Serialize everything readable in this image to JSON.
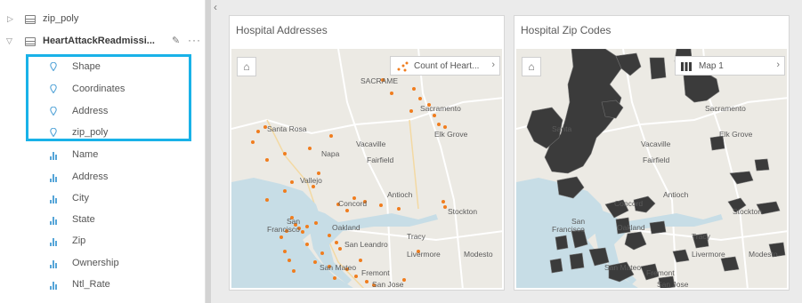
{
  "data_pane": {
    "datasets": [
      {
        "name": "zip_poly",
        "expanded": false
      },
      {
        "name": "HeartAttackReadmissi...",
        "expanded": true
      }
    ],
    "location_fields": [
      "Shape",
      "Coordinates",
      "Address",
      "zip_poly"
    ],
    "number_fields": [
      "Name",
      "Address",
      "City",
      "State",
      "Zip",
      "Ownership",
      "Ntl_Rate"
    ]
  },
  "cards": [
    {
      "title": "Hospital Addresses",
      "legend_label": "Count of Heart...",
      "places": [
        "SACRAME",
        "Sacramento",
        "Santa Rosa",
        "Vacaville",
        "Elk Grove",
        "Napa",
        "Fairfield",
        "Vallejo",
        "Concord",
        "Antioch",
        "Stockton",
        "San",
        "Francisco",
        "Oakland",
        "Tracy",
        "San Leandro",
        "Livermore",
        "Modesto",
        "San Mateo",
        "Fremont",
        "San Jose"
      ]
    },
    {
      "title": "Hospital Zip Codes",
      "legend_label": "Map 1",
      "places": [
        "Sacramento",
        "Santa",
        "Vacaville",
        "Elk Grove",
        "Fairfield",
        "Concord",
        "Antioch",
        "Stockton",
        "San",
        "Francisco",
        "Oakland",
        "Tracy",
        "Livermore",
        "Modesto",
        "San Mateo",
        "Fremont",
        "San Jose"
      ]
    }
  ],
  "icons": {
    "expand": "triangle-right-icon",
    "collapse": "triangle-down-icon",
    "edit": "pencil-icon",
    "more": "ellipsis-icon",
    "home": "home-icon",
    "location": "location-pin-icon",
    "number": "bar-chart-icon",
    "collapse_pane": "chevron-left-icon"
  },
  "colors": {
    "highlight": "#19b2e8",
    "point": "#f07d1e",
    "polygon": "#3b3b3b",
    "water": "#c7dde6",
    "land": "#eceae4",
    "field_icon": "#56a5d8"
  }
}
